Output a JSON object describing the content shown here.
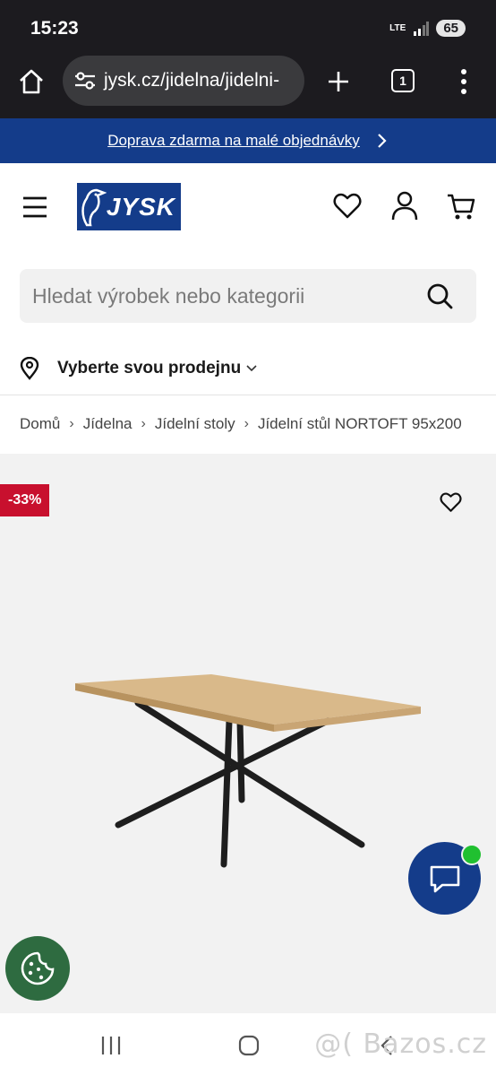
{
  "status_bar": {
    "time": "15:23",
    "network": "LTE",
    "battery": "65"
  },
  "browser": {
    "url": "jysk.cz/jidelna/jidelni-",
    "tab_count": "1"
  },
  "promo": {
    "text": "Doprava zdarma na malé objednávky"
  },
  "header": {
    "logo_text": "JYSK"
  },
  "search": {
    "placeholder": "Hledat výrobek nebo kategorii"
  },
  "store": {
    "label": "Vyberte svou prodejnu"
  },
  "breadcrumb": [
    "Domů",
    "Jídelna",
    "Jídelní stoly",
    "Jídelní stůl NORTOFT 95x200"
  ],
  "product": {
    "discount_badge": "-33%"
  },
  "watermark": "@( Bazos.cz",
  "colors": {
    "brand_blue": "#143c8a",
    "discount_red": "#c8102e",
    "online_green": "#20c030",
    "cookie_green": "#2e6b40"
  },
  "icons": [
    "home-icon",
    "site-settings-icon",
    "new-tab-icon",
    "tabs-icon",
    "more-icon",
    "chevron-right-icon",
    "menu-icon",
    "heart-icon",
    "user-icon",
    "cart-icon",
    "search-icon",
    "location-icon",
    "chevron-down-icon",
    "chat-icon",
    "cookie-icon",
    "recent-apps-icon",
    "home-button-icon",
    "back-icon"
  ]
}
